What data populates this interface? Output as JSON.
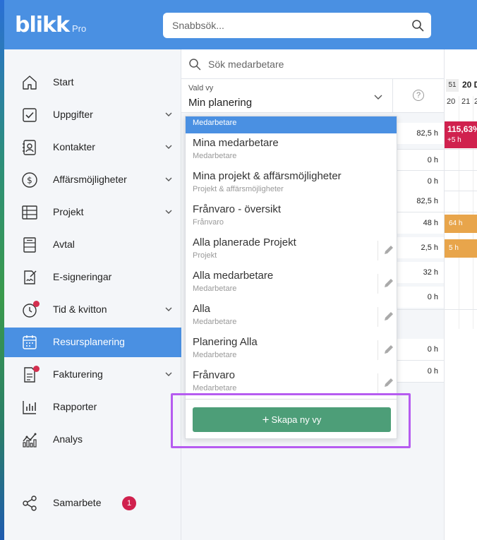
{
  "brand": {
    "name": "blikk",
    "tier": "Pro",
    "header_color": "#4a90e2"
  },
  "search": {
    "placeholder": "Snabbsök..."
  },
  "sidebar": {
    "items": [
      {
        "label": "Start",
        "icon": "home-icon",
        "has_chevron": false
      },
      {
        "label": "Uppgifter",
        "icon": "checkbox-icon",
        "has_chevron": true
      },
      {
        "label": "Kontakter",
        "icon": "contacts-icon",
        "has_chevron": true
      },
      {
        "label": "Affärsmöjligheter",
        "icon": "dollar-icon",
        "has_chevron": true
      },
      {
        "label": "Projekt",
        "icon": "table-icon",
        "has_chevron": true
      },
      {
        "label": "Avtal",
        "icon": "contract-icon",
        "has_chevron": false
      },
      {
        "label": "E-signeringar",
        "icon": "signature-icon",
        "has_chevron": false
      },
      {
        "label": "Tid & kvitton",
        "icon": "clock-icon",
        "has_chevron": true,
        "notification": true
      },
      {
        "label": "Resursplanering",
        "icon": "calendar-icon",
        "has_chevron": false,
        "active": true
      },
      {
        "label": "Fakturering",
        "icon": "invoice-icon",
        "has_chevron": true,
        "notification": true
      },
      {
        "label": "Rapporter",
        "icon": "bar-chart-icon",
        "has_chevron": false
      },
      {
        "label": "Analys",
        "icon": "analytics-icon",
        "has_chevron": false
      }
    ],
    "bottom": {
      "label": "Samarbete",
      "icon": "share-icon",
      "badge": "1"
    }
  },
  "planner": {
    "employee_search_placeholder": "Sök medarbetare",
    "view_label": "Vald vy",
    "view_value": "Min planering",
    "help": "?",
    "week": "51",
    "date_header": "20 D",
    "days": [
      "20",
      "21",
      "2"
    ],
    "hours": [
      "82,5 h",
      "0 h",
      "0 h",
      "82,5 h",
      "48 h",
      "2,5 h",
      "32 h",
      "0 h",
      "0 h",
      "0 h"
    ],
    "overbook": {
      "percent": "115,63%",
      "extra": "+5 h"
    },
    "bookings": [
      "64 h",
      "5 h"
    ]
  },
  "dropdown": {
    "top_label": "Medarbetare",
    "items": [
      {
        "title": "Mina medarbetare",
        "subtitle": "Medarbetare",
        "editable": false
      },
      {
        "title": "Mina projekt & affärsmöjligheter",
        "subtitle": "Projekt & affärsmöjligheter",
        "editable": false
      },
      {
        "title": "Frånvaro - översikt",
        "subtitle": "Frånvaro",
        "editable": false
      },
      {
        "title": "Alla planerade Projekt",
        "subtitle": "Projekt",
        "editable": true
      },
      {
        "title": "Alla medarbetare",
        "subtitle": "Medarbetare",
        "editable": true
      },
      {
        "title": "Alla",
        "subtitle": "Medarbetare",
        "editable": true
      },
      {
        "title": "Planering Alla",
        "subtitle": "Medarbetare",
        "editable": true
      },
      {
        "title": "Frånvaro",
        "subtitle": "Medarbetare",
        "editable": true
      }
    ],
    "create_button": "Skapa ny vy",
    "create_button_color": "#4d9e78",
    "highlight_color": "#b65cf0"
  }
}
